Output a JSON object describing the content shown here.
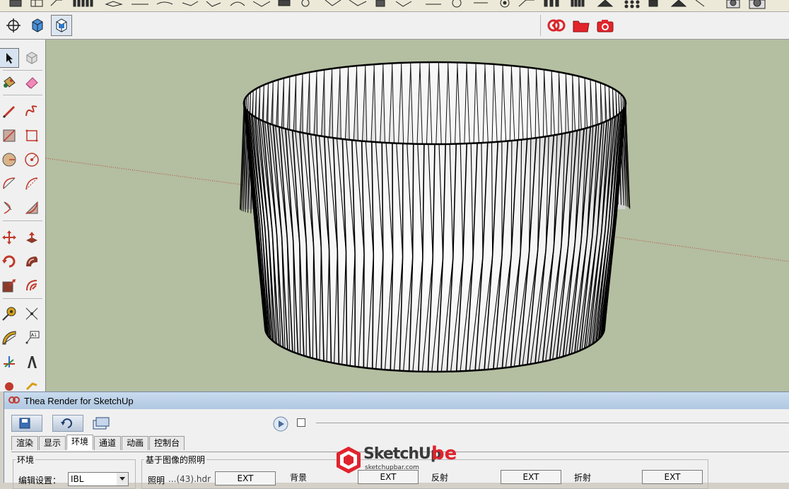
{
  "colors": {
    "viewport_bg": "#b4bea1",
    "accent_red": "#e0242d",
    "panel_title": "#c9dbee"
  },
  "thea_panel": {
    "title": "Thea Render for SketchUp",
    "tabs": [
      {
        "label": "渲染",
        "active": false
      },
      {
        "label": "显示",
        "active": false
      },
      {
        "label": "环境",
        "active": true
      },
      {
        "label": "通道",
        "active": false
      },
      {
        "label": "动画",
        "active": false
      },
      {
        "label": "控制台",
        "active": false
      }
    ],
    "env_group_label": "环境",
    "edit_settings_label": "编辑设置：",
    "edit_settings_value": "IBL",
    "ibl_group_label": "基于图像的照明",
    "lighting_label": "照明",
    "lighting_file": "...(43).hdr",
    "ext_label": "EXT",
    "background_label": "背景",
    "reflection_label": "反射",
    "refraction_label": "折射"
  },
  "watermark": {
    "brand": "SketchUp",
    "suffix": "be",
    "url": "sketchupbar.com"
  },
  "icons": {
    "left_toolbar": [
      "select-arrow-icon",
      "make-component-icon",
      "paint-bucket-icon",
      "eraser-icon",
      "pencil-icon",
      "freehand-icon",
      "rectangle-icon",
      "rotated-rectangle-icon",
      "circle-icon",
      "polygon-icon",
      "arc-icon",
      "pie-icon",
      "two-point-arc-icon",
      "three-point-arc-icon",
      "move-icon",
      "push-pull-icon",
      "rotate-icon",
      "follow-me-icon",
      "scale-icon",
      "offset-icon",
      "tape-measure-icon",
      "dimension-icon",
      "protractor-icon",
      "text-label-icon",
      "axes-icon",
      "3d-text-icon"
    ]
  }
}
